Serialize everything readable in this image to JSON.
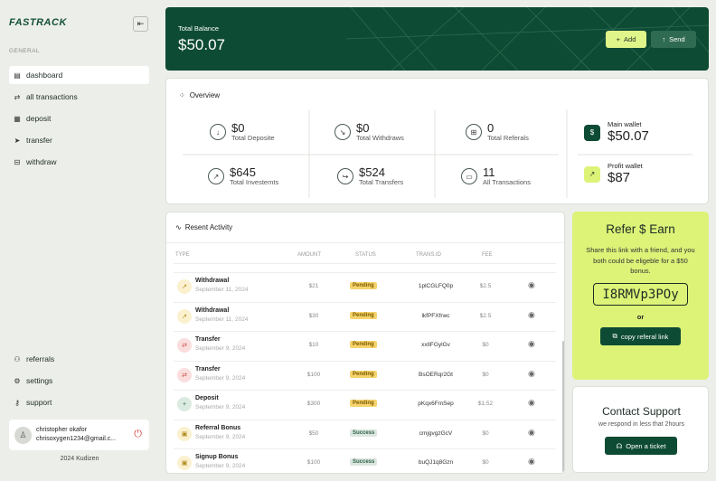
{
  "sidebar": {
    "logo": "FASTRACK",
    "collapse_icon": "collapse-icon",
    "section_label": "GENERAL",
    "items": [
      {
        "label": "dashboard",
        "icon": "dashboard-icon"
      },
      {
        "label": "all transactions",
        "icon": "swap-icon"
      },
      {
        "label": "deposit",
        "icon": "deposit-icon"
      },
      {
        "label": "transfer",
        "icon": "send-icon"
      },
      {
        "label": "withdraw",
        "icon": "withdraw-icon"
      }
    ],
    "bottom_items": [
      {
        "label": "referrals",
        "icon": "users-icon"
      },
      {
        "label": "settings",
        "icon": "gear-icon"
      },
      {
        "label": "support",
        "icon": "key-icon"
      }
    ],
    "user": {
      "name": "christopher okafor",
      "email": "chrisoxygen1234@gmail.c..."
    },
    "copyright": "2024 Kudizen"
  },
  "balance": {
    "label": "Total Balance",
    "value": "$50.07",
    "add_label": "Add",
    "send_label": "Send"
  },
  "overview": {
    "title": "Overview",
    "stats": [
      {
        "value": "$0",
        "label": "Total Deposite",
        "icon": "arrow-down-icon"
      },
      {
        "value": "$0",
        "label": "Total Withdraws",
        "icon": "arrow-down-right-icon"
      },
      {
        "value": "0",
        "label": "Total Referals",
        "icon": "gift-icon"
      },
      {
        "value": "$645",
        "label": "Total Investemts",
        "icon": "trend-up-icon"
      },
      {
        "value": "$524",
        "label": "Total Transfers",
        "icon": "share-icon"
      },
      {
        "value": "11",
        "label": "All Transactions",
        "icon": "folder-icon"
      }
    ],
    "main_wallet": {
      "label": "Main wallet",
      "value": "$50.07"
    },
    "profit_wallet": {
      "label": "Profit wallet",
      "value": "$87"
    }
  },
  "activity": {
    "title": "Resent Activity",
    "columns": [
      "TYPE",
      "AMOUNT",
      "STATUS",
      "TRANS.ID",
      "FEE"
    ],
    "rows": [
      {
        "type": "Withdrawal",
        "date": "September 11, 2024",
        "amount": "$21",
        "status": "Pending",
        "id": "1plCGLFQ0p",
        "fee": "$2.5",
        "kind": "withdraw"
      },
      {
        "type": "Withdrawal",
        "date": "September 11, 2024",
        "amount": "$30",
        "status": "Pending",
        "id": "lkfPFXfrwc",
        "fee": "$2.5",
        "kind": "withdraw"
      },
      {
        "type": "Transfer",
        "date": "September 9, 2024",
        "amount": "$10",
        "status": "Pending",
        "id": "xxIlFGylGv",
        "fee": "$0",
        "kind": "transfer"
      },
      {
        "type": "Transfer",
        "date": "September 9, 2024",
        "amount": "$100",
        "status": "Pending",
        "id": "BsOERqr2Gt",
        "fee": "$0",
        "kind": "transfer"
      },
      {
        "type": "Deposit",
        "date": "September 9, 2024",
        "amount": "$300",
        "status": "Pending",
        "id": "pKqx6FmSep",
        "fee": "$1.52",
        "kind": "deposit"
      },
      {
        "type": "Referral Bonus",
        "date": "September 9, 2024",
        "amount": "$50",
        "status": "Success",
        "id": "cmjgvgzGcV",
        "fee": "$0",
        "kind": "bonus"
      },
      {
        "type": "Signup Bonus",
        "date": "September 9, 2024",
        "amount": "$100",
        "status": "Success",
        "id": "buQJ1q8Gzn",
        "fee": "$0",
        "kind": "bonus"
      }
    ]
  },
  "refer": {
    "title": "Refer $ Earn",
    "text": "Share this link with a friend, and you both could be eligeble for a $50 bonus.",
    "code": "I8RMVp3POy",
    "or": "or",
    "button": "copy referal link"
  },
  "support": {
    "title": "Contact Support",
    "subtitle": "we respond in less that 2hours",
    "button": "Open a ticket"
  }
}
